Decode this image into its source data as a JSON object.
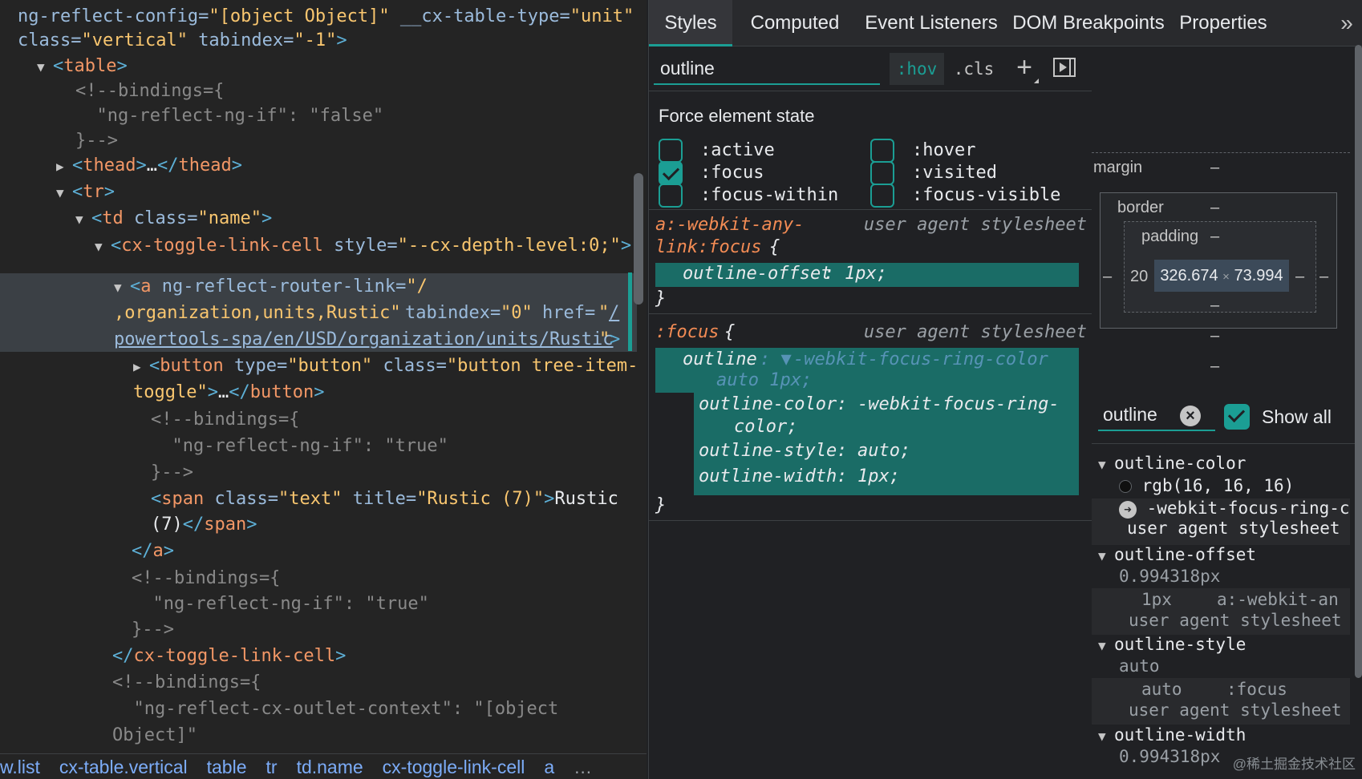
{
  "dom_tree": {
    "lines": [
      {
        "type": "raw",
        "text": "ng-reflect-config=\"[object Object]\" __cx-table-type=\"unit\""
      },
      {
        "type": "raw",
        "text": "class=\"vertical\" tabindex=\"-1\">"
      },
      {
        "type": "tag",
        "text": "<table>"
      },
      {
        "type": "comment",
        "text": "<!--bindings={"
      },
      {
        "type": "comment",
        "text": "  \"ng-reflect-ng-if\": \"false\""
      },
      {
        "type": "comment",
        "text": "}-->"
      },
      {
        "type": "tag",
        "text": "<thead>…</thead>"
      },
      {
        "type": "tag",
        "text": "<tr>"
      },
      {
        "type": "tag",
        "text": "<td class=\"name\">"
      },
      {
        "type": "tag",
        "text": "<cx-toggle-link-cell style=\"--cx-depth-level:0;\">"
      },
      {
        "type": "tag",
        "text": "<a ng-reflect-router-link=\"/"
      },
      {
        "type": "raw",
        "text": ",organization,units,Rustic\" tabindex=\"0\" href=\"/"
      },
      {
        "type": "link",
        "text": "powertools-spa/en/USD/organization/units/Rustic"
      },
      {
        "type": "tag",
        "text": "<button type=\"button\" class=\"button tree-item-"
      },
      {
        "type": "raw",
        "text": "toggle\">…</button>"
      },
      {
        "type": "comment",
        "text": "<!--bindings={"
      },
      {
        "type": "comment",
        "text": "  \"ng-reflect-ng-if\": \"true\""
      },
      {
        "type": "comment",
        "text": "}-->"
      },
      {
        "type": "tag",
        "text": "<span class=\"text\" title=\"Rustic (7)\">Rustic"
      },
      {
        "type": "raw",
        "text": "(7)</span>"
      },
      {
        "type": "tag",
        "text": "</a>"
      },
      {
        "type": "comment",
        "text": "<!--bindings={"
      },
      {
        "type": "comment",
        "text": "  \"ng-reflect-ng-if\": \"true\""
      },
      {
        "type": "comment",
        "text": "}-->"
      },
      {
        "type": "tag",
        "text": "</cx-toggle-link-cell>"
      },
      {
        "type": "comment",
        "text": "<!--bindings={"
      },
      {
        "type": "comment",
        "text": "  \"ng-reflect-cx-outlet-context\": \"[object"
      },
      {
        "type": "comment",
        "text": "Object]\""
      }
    ]
  },
  "breadcrumbs": [
    "w.list",
    "cx-table.vertical",
    "table",
    "tr",
    "td.name",
    "cx-toggle-link-cell",
    "a",
    "…"
  ],
  "tabs": [
    "Styles",
    "Computed",
    "Event Listeners",
    "DOM Breakpoints",
    "Properties"
  ],
  "tab_more": "»",
  "styles_filter": {
    "value": "outline",
    "hov": ":hov",
    "cls": ".cls",
    "plus": "+"
  },
  "force_state": {
    "title": "Force element state",
    "states": [
      {
        "label": ":active",
        "checked": false
      },
      {
        "label": ":focus",
        "checked": true
      },
      {
        "label": ":focus-within",
        "checked": false
      },
      {
        "label": ":hover",
        "checked": false
      },
      {
        "label": ":visited",
        "checked": false
      },
      {
        "label": ":focus-visible",
        "checked": false
      }
    ]
  },
  "rules": [
    {
      "selector_line1": "a:-webkit-any-",
      "selector_line2": "link:focus",
      "open_brace": "{",
      "origin": "user agent stylesheet",
      "props": [
        {
          "name": "outline-offset",
          "value": "1px;"
        }
      ],
      "close_brace": "}"
    },
    {
      "selector": ":focus",
      "open_brace": "{",
      "origin": "user agent stylesheet",
      "shorthand": {
        "name": "outline",
        "value": "-webkit-focus-ring-color",
        "value2": "auto 1px;"
      },
      "props": [
        {
          "name": "outline-color",
          "value": "-webkit-focus-ring-",
          "value2": "color;"
        },
        {
          "name": "outline-style",
          "value": "auto;"
        },
        {
          "name": "outline-width",
          "value": "1px;"
        }
      ],
      "close_brace": "}"
    }
  ],
  "box_model": {
    "margin_label": "margin",
    "margin_value": "–",
    "border_label": "border",
    "border_value": "–",
    "padding_label": "padding",
    "padding_value": "–",
    "left_padding": "20",
    "content_width": "326.674",
    "content_times": "×",
    "content_height": "73.994",
    "dash": "–"
  },
  "computed_filter": {
    "value": "outline",
    "clear": "×",
    "show_all_label": "Show all",
    "show_all_checked": true
  },
  "computed_props": [
    {
      "name": "outline-color",
      "value": "rgb(16, 16, 16)",
      "swatch": "#101010",
      "trace_value": "-webkit-focus-ring-c",
      "trace_origin": "user agent stylesheet"
    },
    {
      "name": "outline-offset",
      "value": "0.994318px",
      "trace_value": "1px",
      "trace_selector": "a:-webkit-an",
      "trace_origin": "user agent stylesheet"
    },
    {
      "name": "outline-style",
      "value": "auto",
      "trace_value": "auto",
      "trace_selector": ":focus",
      "trace_origin": "user agent stylesheet"
    },
    {
      "name": "outline-width",
      "value": "0.994318px"
    }
  ],
  "watermark": "@稀土掘金技术社区",
  "colors": {
    "accent": "#1b9e94",
    "selected_row": "#3b4045",
    "link": "#7cacf8"
  }
}
